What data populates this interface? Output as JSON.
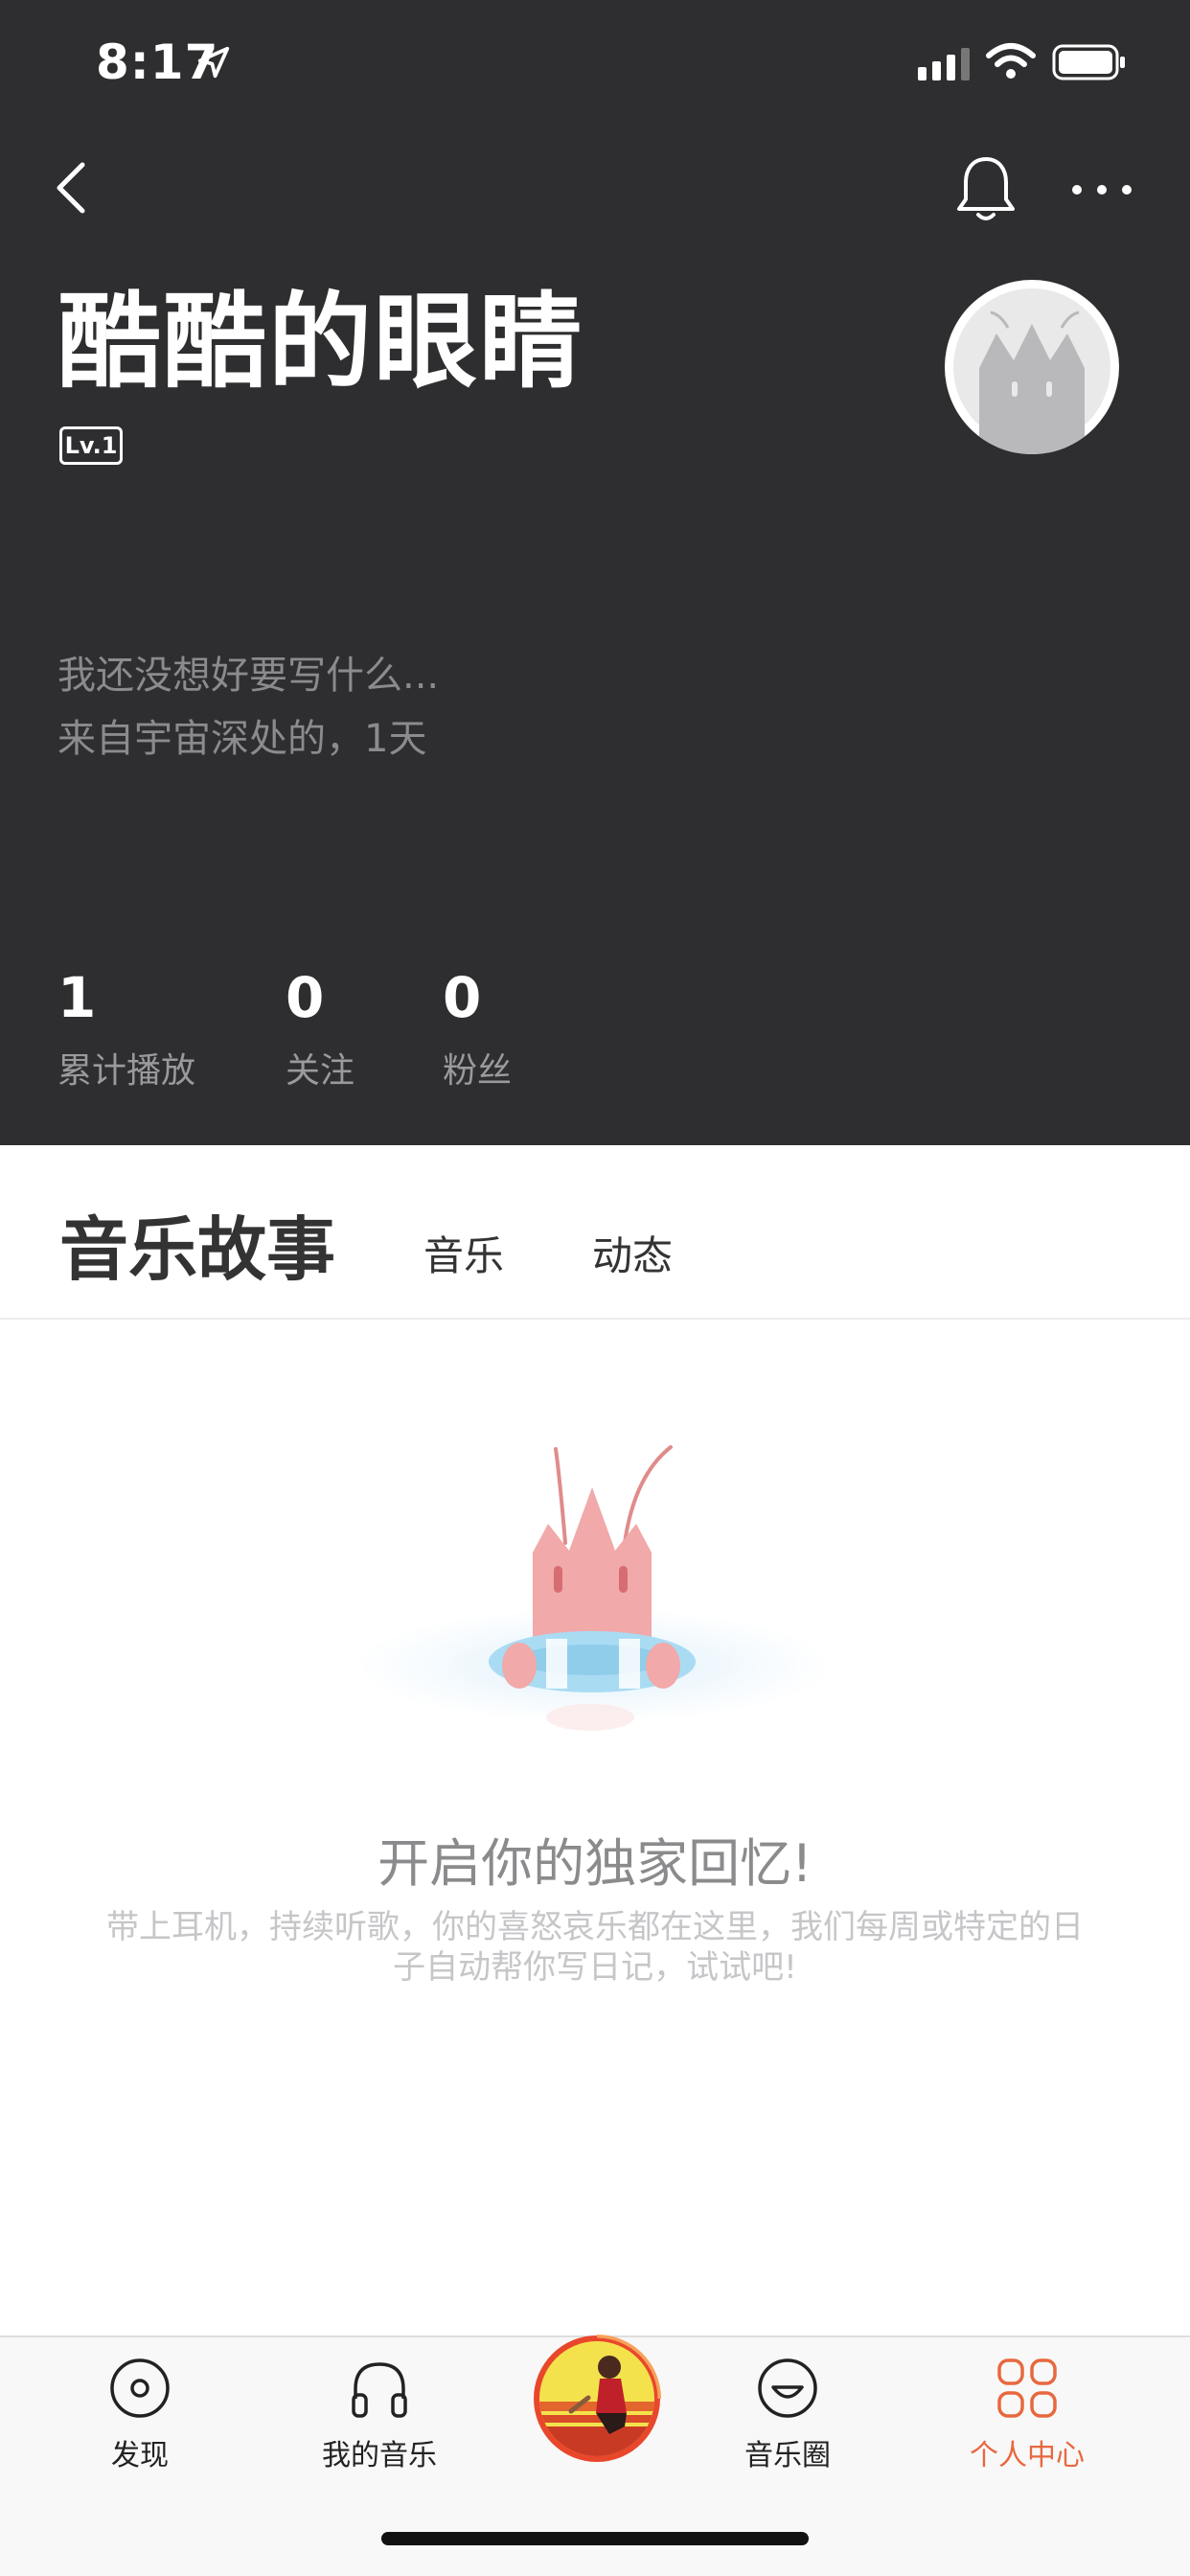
{
  "status_bar": {
    "time": "8:17"
  },
  "profile": {
    "name": "酷酷的眼睛",
    "level": "Lv.1",
    "bio_line1": "我还没想好要写什么...",
    "bio_line2": "来自宇宙深处的，1天"
  },
  "stats": [
    {
      "value": "1",
      "label": "累计播放"
    },
    {
      "value": "0",
      "label": "关注"
    },
    {
      "value": "0",
      "label": "粉丝"
    }
  ],
  "tabs": [
    {
      "label": "音乐故事",
      "active": true
    },
    {
      "label": "音乐",
      "active": false
    },
    {
      "label": "动态",
      "active": false
    }
  ],
  "empty_state": {
    "title": "开启你的独家回忆!",
    "description": "带上耳机，持续听歌，你的喜怒哀乐都在这里，我们每周或特定的日子自动帮你写日记，试试吧!"
  },
  "bottom_nav": [
    {
      "label": "发现",
      "icon": "disc-icon"
    },
    {
      "label": "我的音乐",
      "icon": "headphones-icon"
    },
    {
      "label": "音乐圈",
      "icon": "smile-icon"
    },
    {
      "label": "个人中心",
      "icon": "grid-icon",
      "active": true
    }
  ],
  "colors": {
    "header_bg": "#2e2d2f",
    "accent": "#e8683f",
    "illustration_pink": "#f1a9a9"
  }
}
